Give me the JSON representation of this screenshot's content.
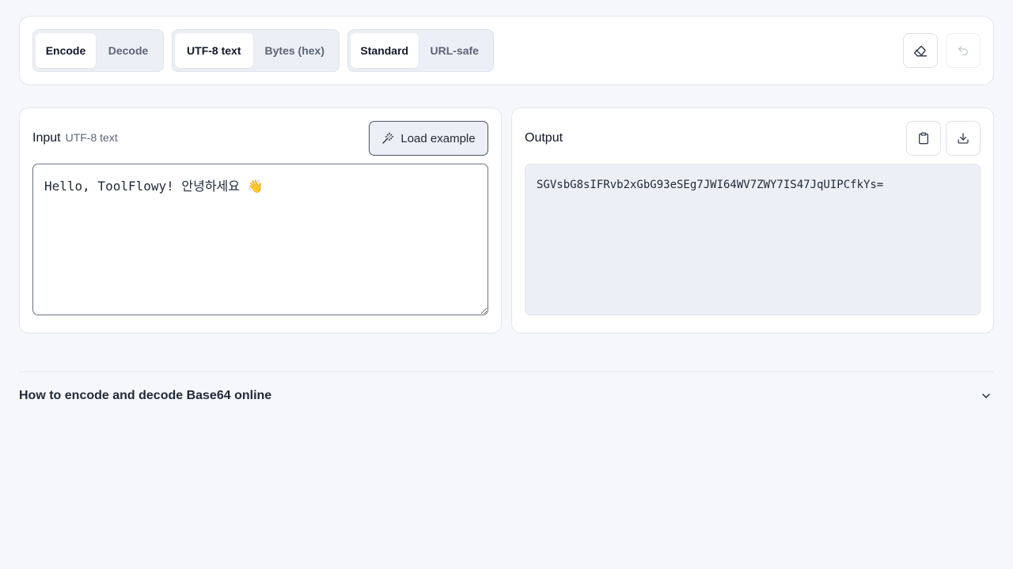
{
  "toolbar": {
    "mode": {
      "encode": "Encode",
      "decode": "Decode",
      "selected": "Encode"
    },
    "input_format": {
      "utf8": "UTF-8 text",
      "hex": "Bytes (hex)",
      "selected": "UTF-8 text"
    },
    "variant": {
      "standard": "Standard",
      "urlsafe": "URL-safe",
      "selected": "Standard"
    },
    "icons": {
      "clear": "eraser-icon",
      "undo": "undo-icon"
    }
  },
  "input_panel": {
    "title": "Input",
    "subtitle": "UTF-8 text",
    "load_example_label": "Load example",
    "load_example_icon": "magic-wand-icon",
    "value": "Hello, ToolFlowy! 안녕하세요 👋"
  },
  "output_panel": {
    "title": "Output",
    "value": "SGVsbG8sIFRvb2xGbG93eSEg7JWI64WV7ZWY7IS47JqUIPCfkYs=",
    "icons": {
      "copy": "clipboard-icon",
      "download": "download-icon"
    }
  },
  "faq": {
    "label": "How to encode and decode Base64 online",
    "icon": "chevron-down-icon"
  },
  "colors": {
    "background": "#f6f7fb",
    "surface": "#ffffff",
    "muted_surface": "#eceff5",
    "border": "#e3e6ee",
    "text": "#1f2937"
  }
}
